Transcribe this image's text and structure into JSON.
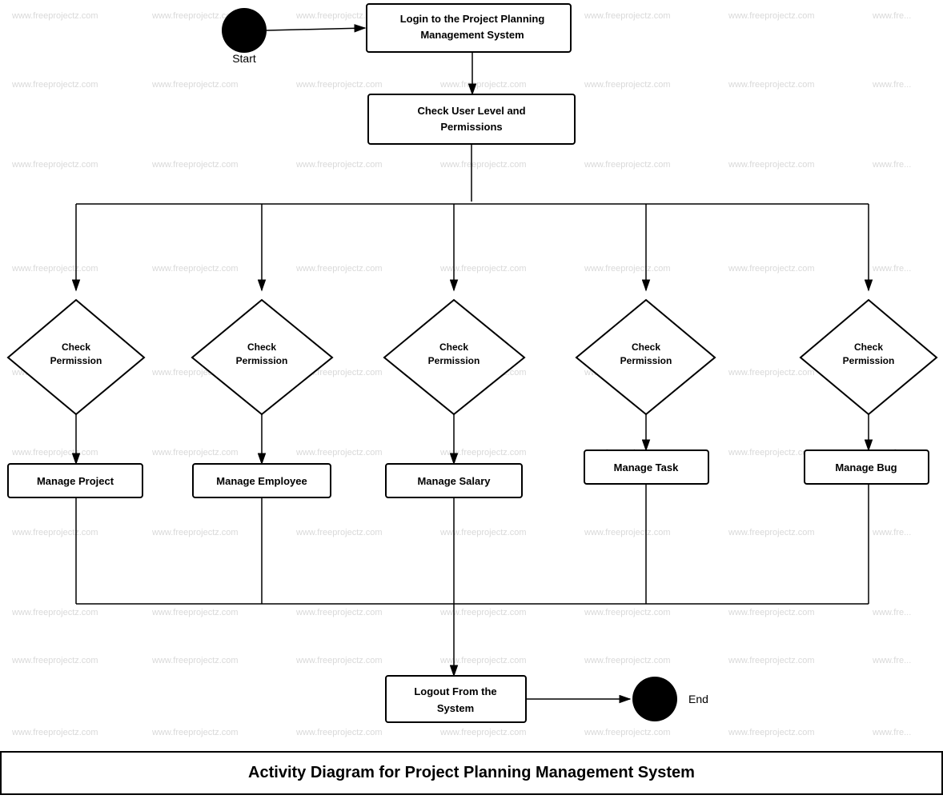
{
  "diagram": {
    "title": "Activity Diagram for Project Planning Management System",
    "watermark_text": "www.freeprojectz.com",
    "nodes": {
      "start": {
        "label": "Start",
        "type": "circle"
      },
      "login": {
        "label": "Login to the Project Planning Management System",
        "type": "rectangle"
      },
      "check_user": {
        "label": "Check User Level and Permissions",
        "type": "rectangle"
      },
      "check_perm_1": {
        "label": "Check Permission",
        "type": "diamond"
      },
      "check_perm_2": {
        "label": "Check Permission",
        "type": "diamond"
      },
      "check_perm_3": {
        "label": "Check Permission",
        "type": "diamond"
      },
      "check_perm_4": {
        "label": "Check Permission",
        "type": "diamond"
      },
      "check_perm_5": {
        "label": "Check Permission",
        "type": "diamond"
      },
      "manage_project": {
        "label": "Manage Project",
        "type": "rectangle"
      },
      "manage_employee": {
        "label": "Manage Employee",
        "type": "rectangle"
      },
      "manage_salary": {
        "label": "Manage Salary",
        "type": "rectangle"
      },
      "manage_task": {
        "label": "Manage Task",
        "type": "rectangle"
      },
      "manage_bug": {
        "label": "Manage Bug",
        "type": "rectangle"
      },
      "logout": {
        "label": "Logout From the System",
        "type": "rectangle"
      },
      "end": {
        "label": "End",
        "type": "circle"
      }
    }
  }
}
